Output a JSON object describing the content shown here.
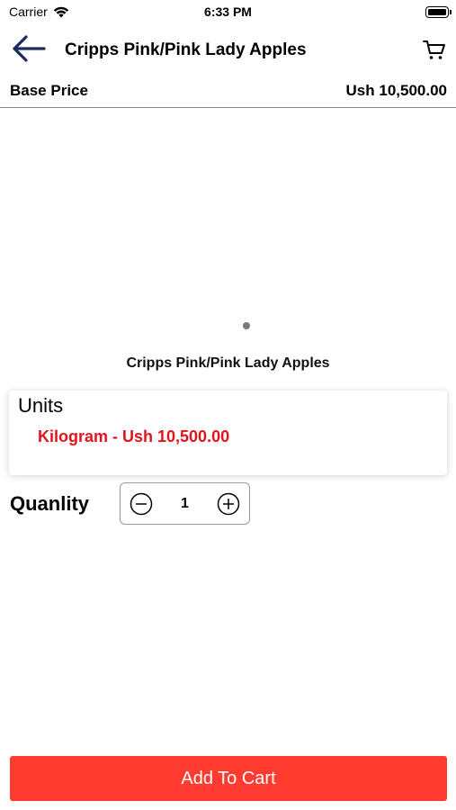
{
  "status_bar": {
    "carrier": "Carrier",
    "time": "6:33 PM"
  },
  "nav": {
    "title": "Cripps Pink/Pink Lady Apples",
    "back_icon": "arrow-left-icon",
    "cart_icon": "cart-icon"
  },
  "base_price": {
    "label": "Base Price",
    "value": "Ush 10,500.00"
  },
  "carousel": {
    "page_count": 1,
    "current_page": 1
  },
  "product": {
    "name": "Cripps Pink/Pink Lady Apples"
  },
  "units": {
    "title": "Units",
    "options": [
      {
        "label": "Kilogram - Ush 10,500.00",
        "selected": true
      }
    ]
  },
  "quantity": {
    "label": "Quanlity",
    "value": "1"
  },
  "actions": {
    "add_to_cart": "Add To Cart"
  },
  "colors": {
    "accent": "#ff3b30",
    "unit_option": "#e3131b",
    "nav_arrow": "#1c2a5c"
  }
}
